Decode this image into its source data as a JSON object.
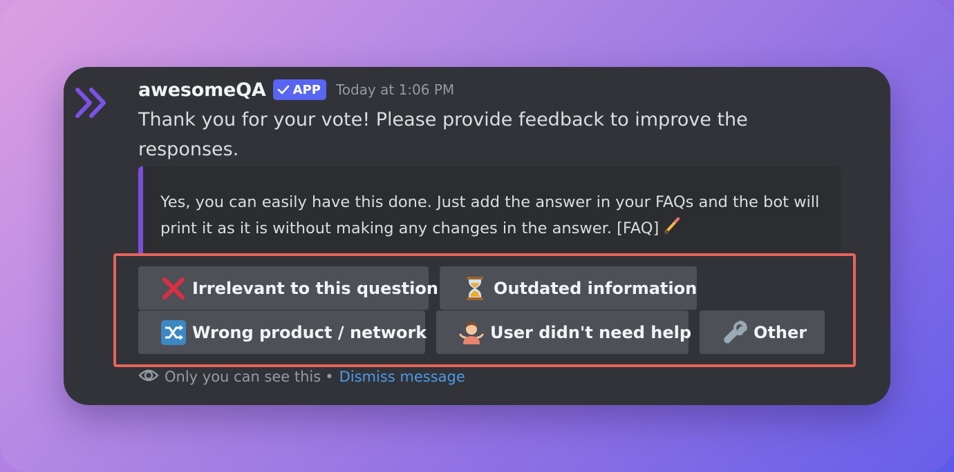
{
  "message": {
    "author": "awesomeQA",
    "badge_label": "APP",
    "timestamp": "Today at 1:06 PM",
    "text": "Thank you for your vote! Please provide feedback to improve the responses."
  },
  "embed": {
    "text": "Yes, you can easily have this done. Just add the answer in your FAQs and the bot will print it as it is without making any changes in the answer. [FAQ]",
    "accent_color": "#7c4ddc"
  },
  "buttons": {
    "irrelevant": {
      "label": "Irrelevant to this question",
      "icon": "cross-mark-icon"
    },
    "outdated": {
      "label": "Outdated information",
      "icon": "hourglass-icon"
    },
    "wrong_product": {
      "label": "Wrong product / network",
      "icon": "shuffle-icon"
    },
    "no_help": {
      "label": "User didn't need help",
      "icon": "person-shrugging-icon"
    },
    "other": {
      "label": "Other",
      "icon": "wrench-icon"
    }
  },
  "footer": {
    "visibility_note": "Only you can see this",
    "separator": "•",
    "dismiss_label": "Dismiss message"
  },
  "colors": {
    "card_background": "#323339",
    "button_background": "#4e5058",
    "badge": "#5865f2",
    "link": "#4b9ae6",
    "highlight_border": "#e8645a"
  }
}
